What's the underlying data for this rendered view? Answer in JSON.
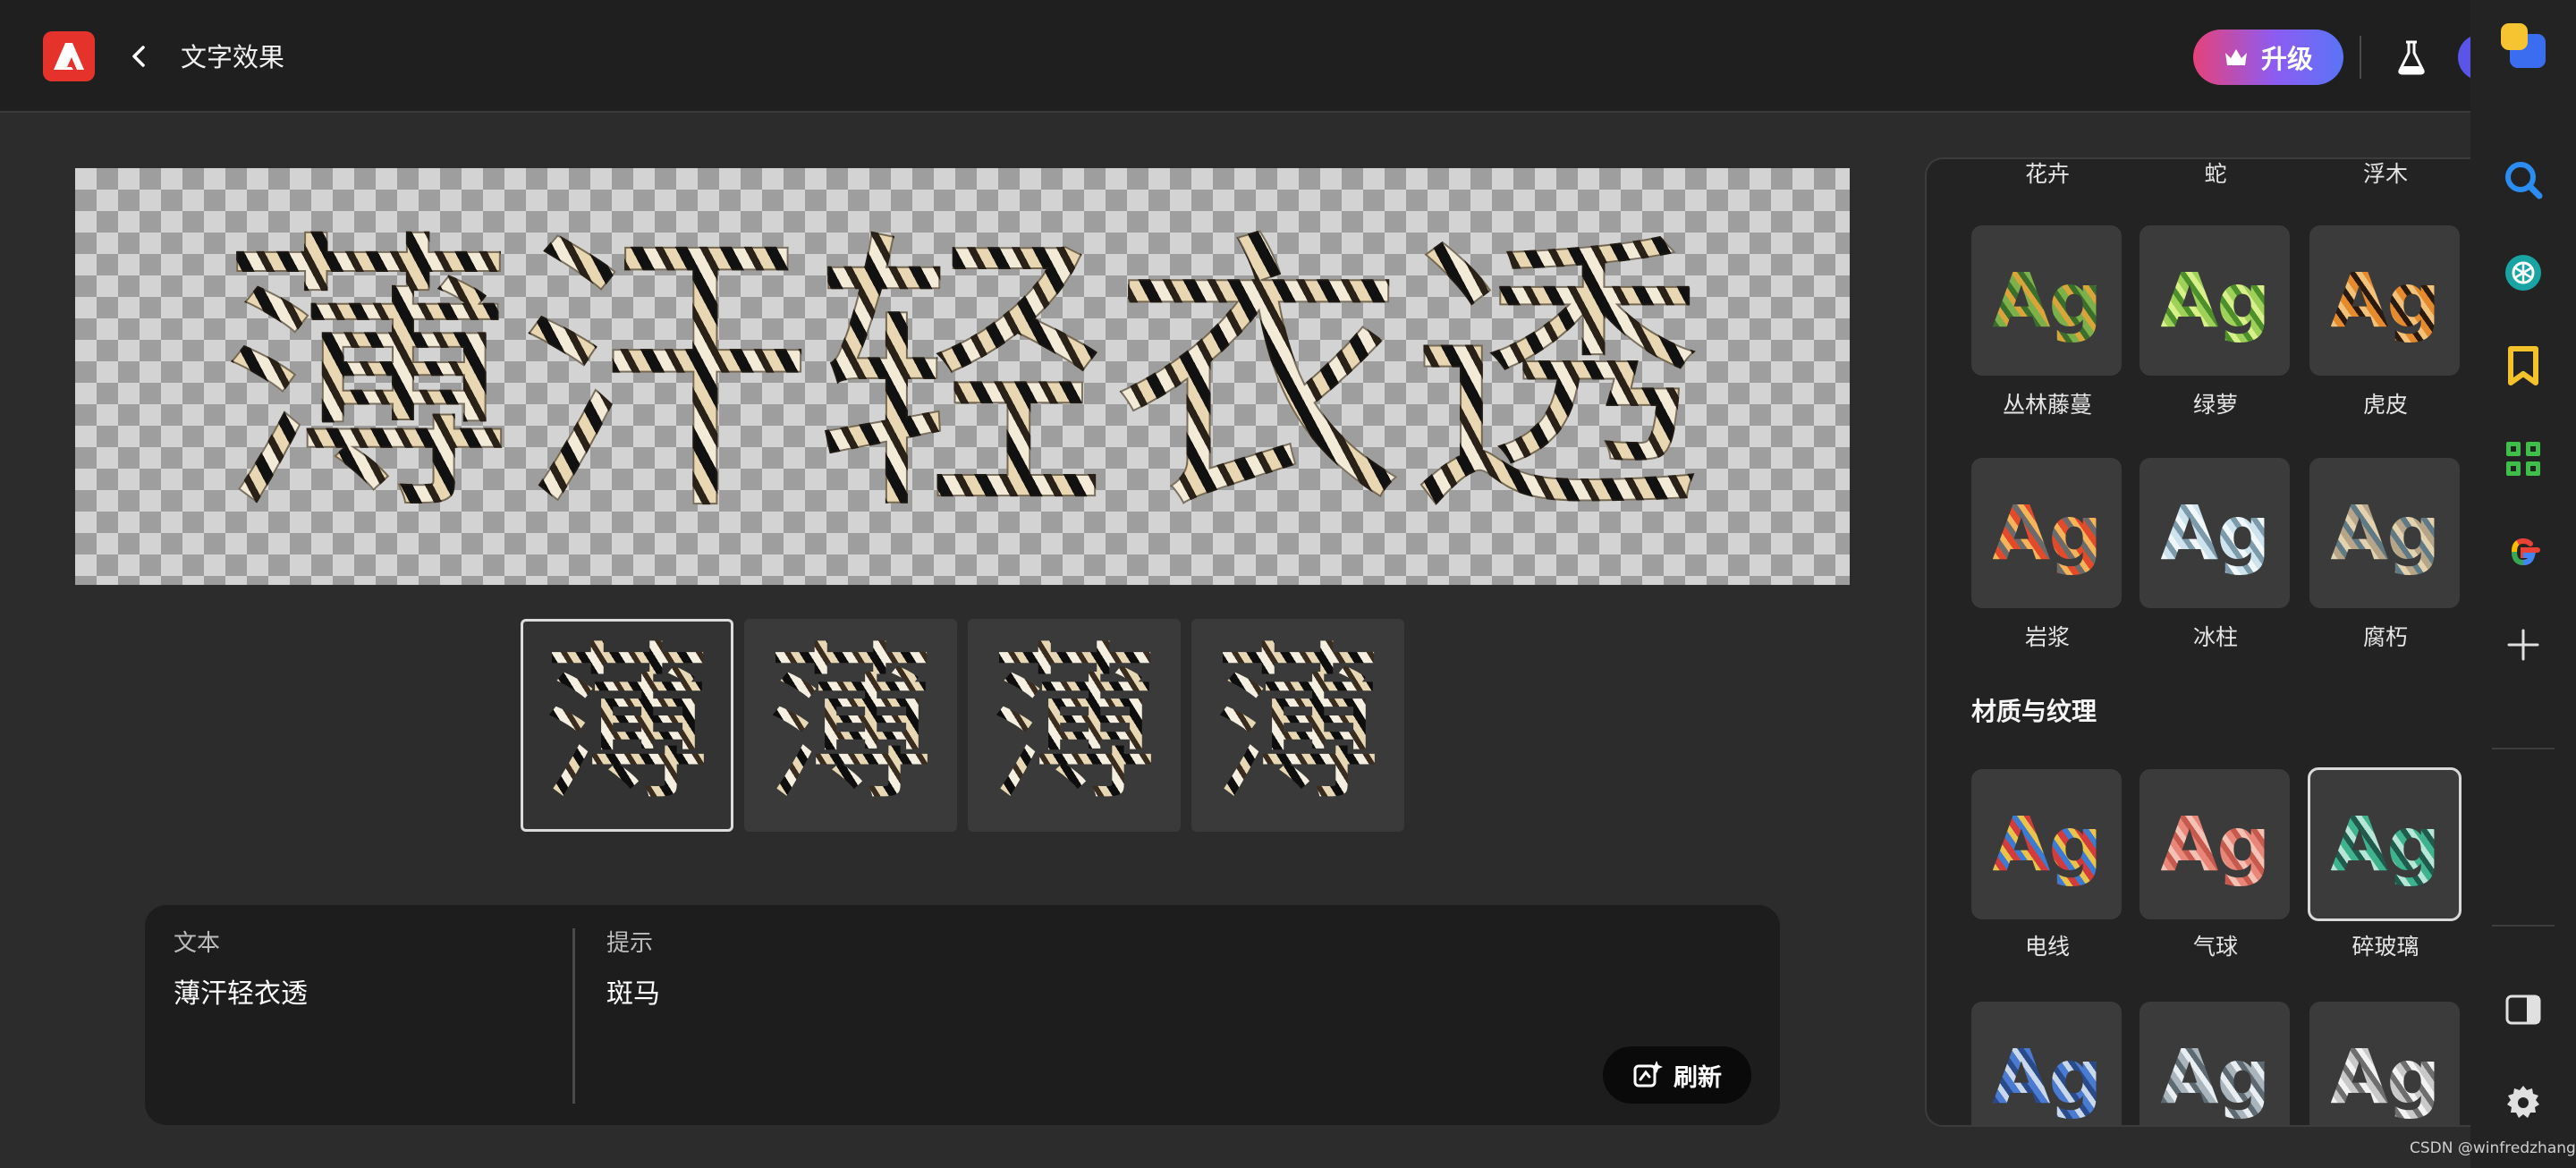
{
  "header": {
    "title": "文字效果",
    "upgrade_label": "升级"
  },
  "canvas": {
    "text": "薄汗轻衣透"
  },
  "thumbnails": [
    {
      "glyph": "薄",
      "selected": true
    },
    {
      "glyph": "薄",
      "selected": false
    },
    {
      "glyph": "薄",
      "selected": false
    },
    {
      "glyph": "薄",
      "selected": false
    }
  ],
  "prompt": {
    "text_label": "文本",
    "text_value": "薄汗轻衣透",
    "hint_label": "提示",
    "hint_value": "斑马",
    "refresh_label": "刷新"
  },
  "effects": {
    "top_labels": [
      "花卉",
      "蛇",
      "浮木"
    ],
    "row1": [
      {
        "tile": "Ag",
        "label": "丛林藤蔓",
        "colors": [
          "#7bb04a",
          "#d9a43a",
          "#3b6e2c"
        ]
      },
      {
        "tile": "Ag",
        "label": "绿萝",
        "colors": [
          "#9ed05a",
          "#4d8f2a",
          "#d8f08a"
        ]
      },
      {
        "tile": "Ag",
        "label": "虎皮",
        "colors": [
          "#e58b2e",
          "#2a1a0e",
          "#f3c27a"
        ]
      }
    ],
    "row2": [
      {
        "tile": "Ag",
        "label": "岩浆",
        "colors": [
          "#e24a2a",
          "#6b6b6b",
          "#f5b35a"
        ]
      },
      {
        "tile": "Ag",
        "label": "冰柱",
        "colors": [
          "#cfe3ee",
          "#7d9aaa",
          "#f2f7fa"
        ]
      },
      {
        "tile": "Ag",
        "label": "腐朽",
        "colors": [
          "#b7a58a",
          "#5f7a84",
          "#e3d2b0"
        ]
      }
    ],
    "section_title": "材质与纹理",
    "row3": [
      {
        "tile": "Ag",
        "label": "电线",
        "colors": [
          "#d43b3b",
          "#3b7bd4",
          "#e8c44a"
        ],
        "selected": false
      },
      {
        "tile": "Ag",
        "label": "气球",
        "colors": [
          "#e8867a",
          "#c65a4e",
          "#f4c2b4"
        ],
        "selected": false
      },
      {
        "tile": "Ag",
        "label": "碎玻璃",
        "colors": [
          "#3fb28e",
          "#1f5a4c",
          "#b8e6d6"
        ],
        "selected": true
      }
    ],
    "row4": [
      {
        "tile": "Ag",
        "colors": [
          "#4a7bd0",
          "#c9d8ea",
          "#2a4a8a"
        ]
      },
      {
        "tile": "Ag",
        "colors": [
          "#a9b4bc",
          "#e8eef2",
          "#5e6a72"
        ]
      },
      {
        "tile": "Ag",
        "colors": [
          "#c9c9c9",
          "#6e6e6e",
          "#f2f2f2"
        ]
      }
    ]
  },
  "rail": {
    "icons": [
      "app-badge-icon",
      "search-icon",
      "openai-icon",
      "bookmark-icon",
      "grid-apps-icon",
      "google-icon",
      "plus-icon",
      "sidebar-toggle-icon",
      "gear-icon"
    ]
  },
  "watermark": "CSDN @winfredzhang",
  "colors": {
    "accent_red": "#e5322b",
    "upgrade_gradient": [
      "#e5427a",
      "#8c5cf2",
      "#5a74f7"
    ],
    "panel_bg": "#1d1d1d"
  }
}
